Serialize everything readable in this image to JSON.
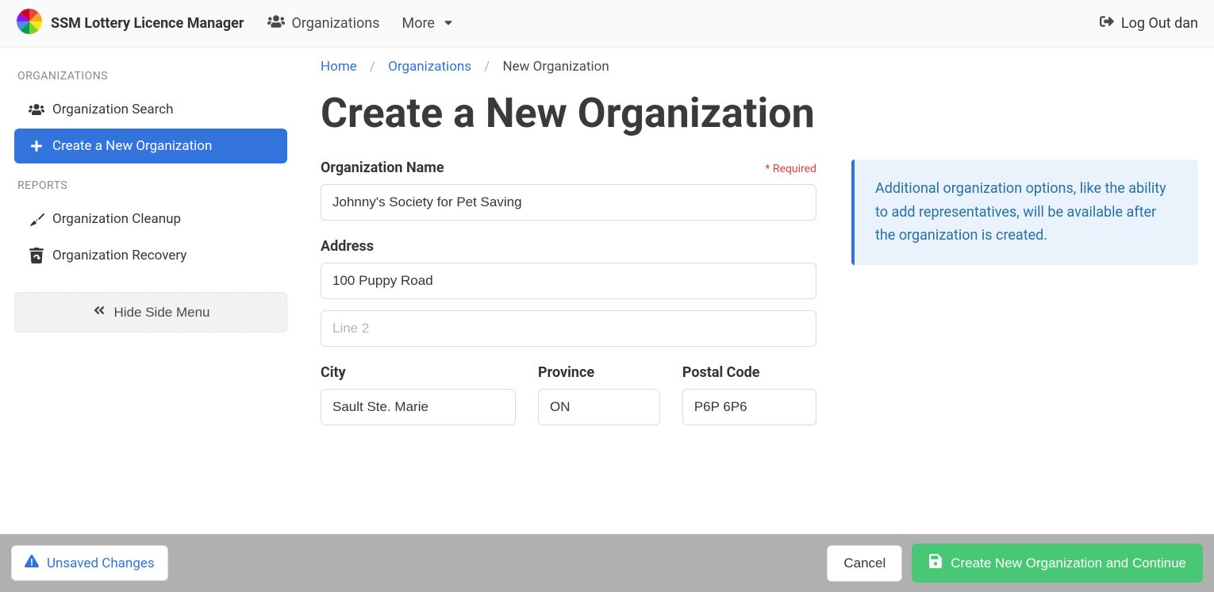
{
  "header": {
    "brand": "SSM Lottery Licence Manager",
    "nav": {
      "organizations": "Organizations",
      "more": "More"
    },
    "logout": "Log Out dan"
  },
  "sidebar": {
    "heading_orgs": "ORGANIZATIONS",
    "items_orgs": [
      {
        "label": "Organization Search"
      },
      {
        "label": "Create a New Organization"
      }
    ],
    "heading_reports": "REPORTS",
    "items_reports": [
      {
        "label": "Organization Cleanup"
      },
      {
        "label": "Organization Recovery"
      }
    ],
    "hide_menu": "Hide Side Menu"
  },
  "breadcrumb": {
    "home": "Home",
    "orgs": "Organizations",
    "current": "New Organization"
  },
  "page": {
    "title": "Create a New Organization"
  },
  "form": {
    "org_name_label": "Organization Name",
    "required_text": "* Required",
    "org_name_value": "Johnny's Society for Pet Saving",
    "address_label": "Address",
    "address1_value": "100 Puppy Road",
    "address2_placeholder": "Line 2",
    "address2_value": "",
    "city_label": "City",
    "city_value": "Sault Ste. Marie",
    "province_label": "Province",
    "province_value": "ON",
    "postal_label": "Postal Code",
    "postal_value": "P6P 6P6"
  },
  "info": {
    "text": "Additional organization options, like the ability to add representatives, will be available after the organization is created."
  },
  "footer": {
    "unsaved": "Unsaved Changes",
    "cancel": "Cancel",
    "submit": "Create New Organization and Continue"
  }
}
